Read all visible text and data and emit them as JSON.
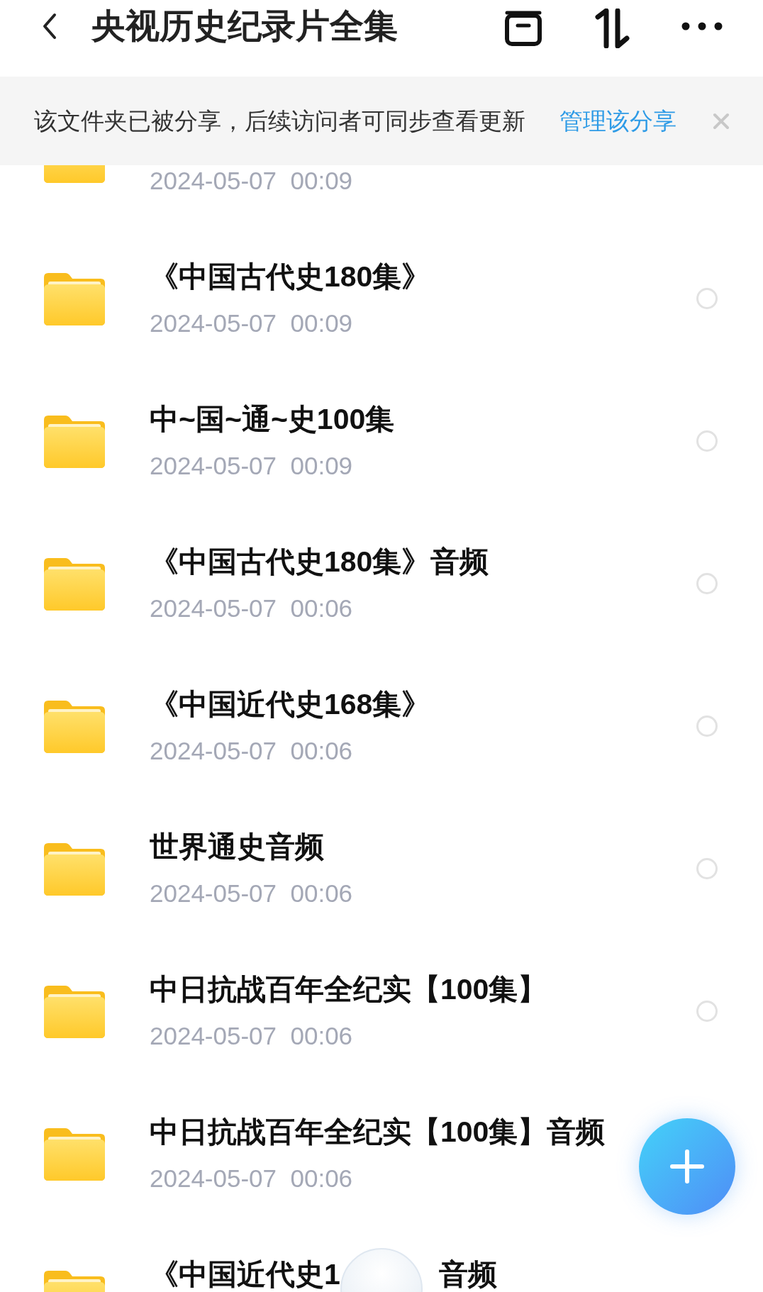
{
  "header": {
    "title": "央视历史纪录片全集"
  },
  "share_banner": {
    "message": "该文件夹已被分享，后续访问者可同步查看更新",
    "link": "管理该分享"
  },
  "folders": [
    {
      "date": "2024-05-07  00:09"
    },
    {
      "title": "《中国古代史180集》",
      "date": "2024-05-07  00:09",
      "selected": false
    },
    {
      "title": "中~国~通~史100集",
      "date": "2024-05-07  00:09",
      "selected": false
    },
    {
      "title": "《中国古代史180集》音频",
      "date": "2024-05-07  00:06",
      "selected": false
    },
    {
      "title": "《中国近代史168集》",
      "date": "2024-05-07  00:06",
      "selected": false
    },
    {
      "title": "世界通史音频",
      "date": "2024-05-07  00:06",
      "selected": false
    },
    {
      "title": "中日抗战百年全纪实【100集】",
      "date": "2024-05-07  00:06",
      "selected": false
    },
    {
      "title": "中日抗战百年全纪实【100集】音频",
      "date": "2024-05-07  00:06"
    },
    {
      "title_parts": [
        "《中国近代史1",
        "音频"
      ]
    }
  ]
}
